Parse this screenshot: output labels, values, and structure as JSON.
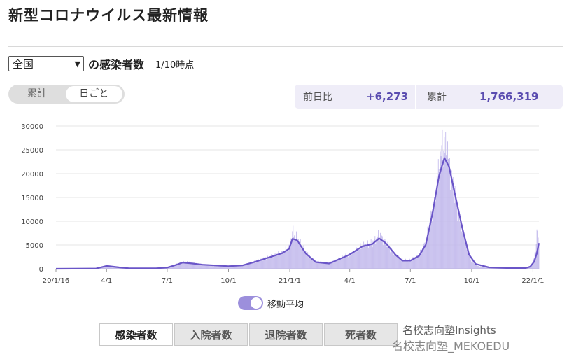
{
  "page": {
    "title": "新型コロナウイルス最新情報"
  },
  "filter": {
    "region": "全国",
    "label": "の感染者数",
    "as_of": "1/10時点"
  },
  "toggle": {
    "cumulative": "累計",
    "daily": "日ごと"
  },
  "stats": {
    "prev_day_label": "前日比",
    "prev_day_value": "+6,273",
    "total_label": "累計",
    "total_value": "1,766,319"
  },
  "legend": {
    "moving_avg": "移動平均"
  },
  "tabs": [
    "感染者数",
    "入院者数",
    "退院者数",
    "死者数"
  ],
  "watermark": {
    "line1": "名校志向塾Insights",
    "line2": "名校志向塾_MEKOEDU"
  },
  "colors": {
    "bar": "#c2b9ec",
    "line": "#6a55c8",
    "accent": "#5a4cb0"
  },
  "chart_data": {
    "type": "bar",
    "title": "",
    "xlabel": "",
    "ylabel": "",
    "ylim": [
      0,
      30000
    ],
    "yticks": [
      0,
      5000,
      10000,
      15000,
      20000,
      25000,
      30000
    ],
    "x_tick_labels": [
      "20/1/16",
      "4/1",
      "7/1",
      "10/1",
      "21/1/1",
      "4/1",
      "7/1",
      "10/1",
      "22/1/1"
    ],
    "x_tick_days": [
      0,
      76,
      167,
      259,
      351,
      441,
      532,
      624,
      716
    ],
    "x_range_days": [
      0,
      725
    ],
    "series": [
      {
        "name": "daily cases (bars)",
        "points": [
          [
            0,
            0
          ],
          [
            60,
            100
          ],
          [
            76,
            600
          ],
          [
            85,
            500
          ],
          [
            95,
            300
          ],
          [
            110,
            100
          ],
          [
            130,
            50
          ],
          [
            150,
            100
          ],
          [
            167,
            300
          ],
          [
            180,
            900
          ],
          [
            190,
            1400
          ],
          [
            200,
            1400
          ],
          [
            210,
            1100
          ],
          [
            220,
            900
          ],
          [
            240,
            600
          ],
          [
            259,
            600
          ],
          [
            280,
            700
          ],
          [
            300,
            1600
          ],
          [
            320,
            2500
          ],
          [
            340,
            3400
          ],
          [
            351,
            4500
          ],
          [
            355,
            7800
          ],
          [
            362,
            6500
          ],
          [
            375,
            3500
          ],
          [
            390,
            1500
          ],
          [
            410,
            1200
          ],
          [
            430,
            2400
          ],
          [
            441,
            3000
          ],
          [
            460,
            4800
          ],
          [
            475,
            5400
          ],
          [
            485,
            7200
          ],
          [
            495,
            5500
          ],
          [
            510,
            3000
          ],
          [
            520,
            1800
          ],
          [
            532,
            1800
          ],
          [
            545,
            2800
          ],
          [
            555,
            5500
          ],
          [
            565,
            12000
          ],
          [
            575,
            21000
          ],
          [
            580,
            26000
          ],
          [
            587,
            25000
          ],
          [
            595,
            18000
          ],
          [
            605,
            11000
          ],
          [
            615,
            5000
          ],
          [
            624,
            1500
          ],
          [
            635,
            500
          ],
          [
            650,
            200
          ],
          [
            680,
            150
          ],
          [
            700,
            120
          ],
          [
            712,
            500
          ],
          [
            716,
            1200
          ],
          [
            720,
            4000
          ],
          [
            723,
            8400
          ],
          [
            725,
            5000
          ]
        ]
      },
      {
        "name": "移動平均",
        "points": [
          [
            0,
            0
          ],
          [
            60,
            50
          ],
          [
            76,
            600
          ],
          [
            95,
            300
          ],
          [
            110,
            100
          ],
          [
            150,
            100
          ],
          [
            167,
            250
          ],
          [
            180,
            800
          ],
          [
            190,
            1300
          ],
          [
            205,
            1100
          ],
          [
            220,
            850
          ],
          [
            259,
            550
          ],
          [
            280,
            700
          ],
          [
            300,
            1500
          ],
          [
            320,
            2400
          ],
          [
            340,
            3300
          ],
          [
            350,
            4200
          ],
          [
            355,
            6300
          ],
          [
            362,
            6000
          ],
          [
            375,
            3200
          ],
          [
            390,
            1400
          ],
          [
            410,
            1100
          ],
          [
            430,
            2300
          ],
          [
            441,
            3000
          ],
          [
            460,
            4700
          ],
          [
            475,
            5200
          ],
          [
            485,
            6400
          ],
          [
            495,
            5400
          ],
          [
            510,
            2900
          ],
          [
            520,
            1700
          ],
          [
            532,
            1700
          ],
          [
            545,
            2700
          ],
          [
            555,
            5000
          ],
          [
            565,
            11500
          ],
          [
            575,
            19500
          ],
          [
            583,
            23300
          ],
          [
            590,
            21500
          ],
          [
            600,
            15000
          ],
          [
            610,
            8500
          ],
          [
            620,
            3000
          ],
          [
            630,
            1000
          ],
          [
            650,
            300
          ],
          [
            680,
            150
          ],
          [
            705,
            150
          ],
          [
            712,
            450
          ],
          [
            718,
            1500
          ],
          [
            722,
            3300
          ],
          [
            725,
            5400
          ]
        ]
      }
    ],
    "grid": true,
    "legend_position": "bottom-center"
  }
}
